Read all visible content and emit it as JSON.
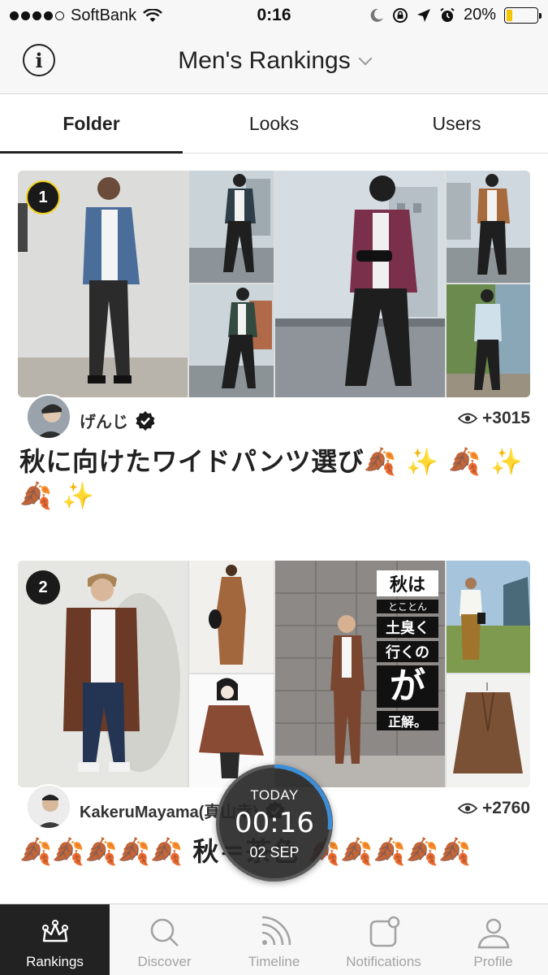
{
  "status_bar": {
    "carrier": "SoftBank",
    "time": "0:16",
    "battery": "20%",
    "battery_level": 0.2,
    "signal_bars_filled": 4,
    "signal_bars_total": 5
  },
  "nav": {
    "title": "Men's Rankings"
  },
  "tabs": [
    {
      "label": "Folder",
      "active": true
    },
    {
      "label": "Looks",
      "active": false
    },
    {
      "label": "Users",
      "active": false
    }
  ],
  "feed": [
    {
      "rank": "1",
      "username": "げんじ",
      "verified": true,
      "views": "+3015",
      "title": "秋に向けたワイドパンツ選び🍂 ✨ 🍂 ✨ 🍂 ✨"
    },
    {
      "rank": "2",
      "username": "KakeruMayama(真山幸)",
      "verified": true,
      "views": "+2760",
      "title": "🍂🍂🍂🍂🍂 秋＝茶色 🍂🍂🍂🍂🍂",
      "overlay_text": [
        "秋は",
        "とことん",
        "土臭く",
        "行くの",
        "が",
        "正解。"
      ]
    }
  ],
  "clock": {
    "label": "TODAY",
    "time": "00:16",
    "date": "02 SEP"
  },
  "tabbar": [
    {
      "label": "Rankings",
      "icon": "crown-icon",
      "active": true
    },
    {
      "label": "Discover",
      "icon": "search-icon",
      "active": false
    },
    {
      "label": "Timeline",
      "icon": "feed-icon",
      "active": false
    },
    {
      "label": "Notifications",
      "icon": "notification-icon",
      "active": false
    },
    {
      "label": "Profile",
      "icon": "profile-icon",
      "active": false
    }
  ],
  "colors": {
    "active_tab_bg": "#222222",
    "rank1_ring": "#f3d21a",
    "clock_arc": "#3b8fd9"
  }
}
